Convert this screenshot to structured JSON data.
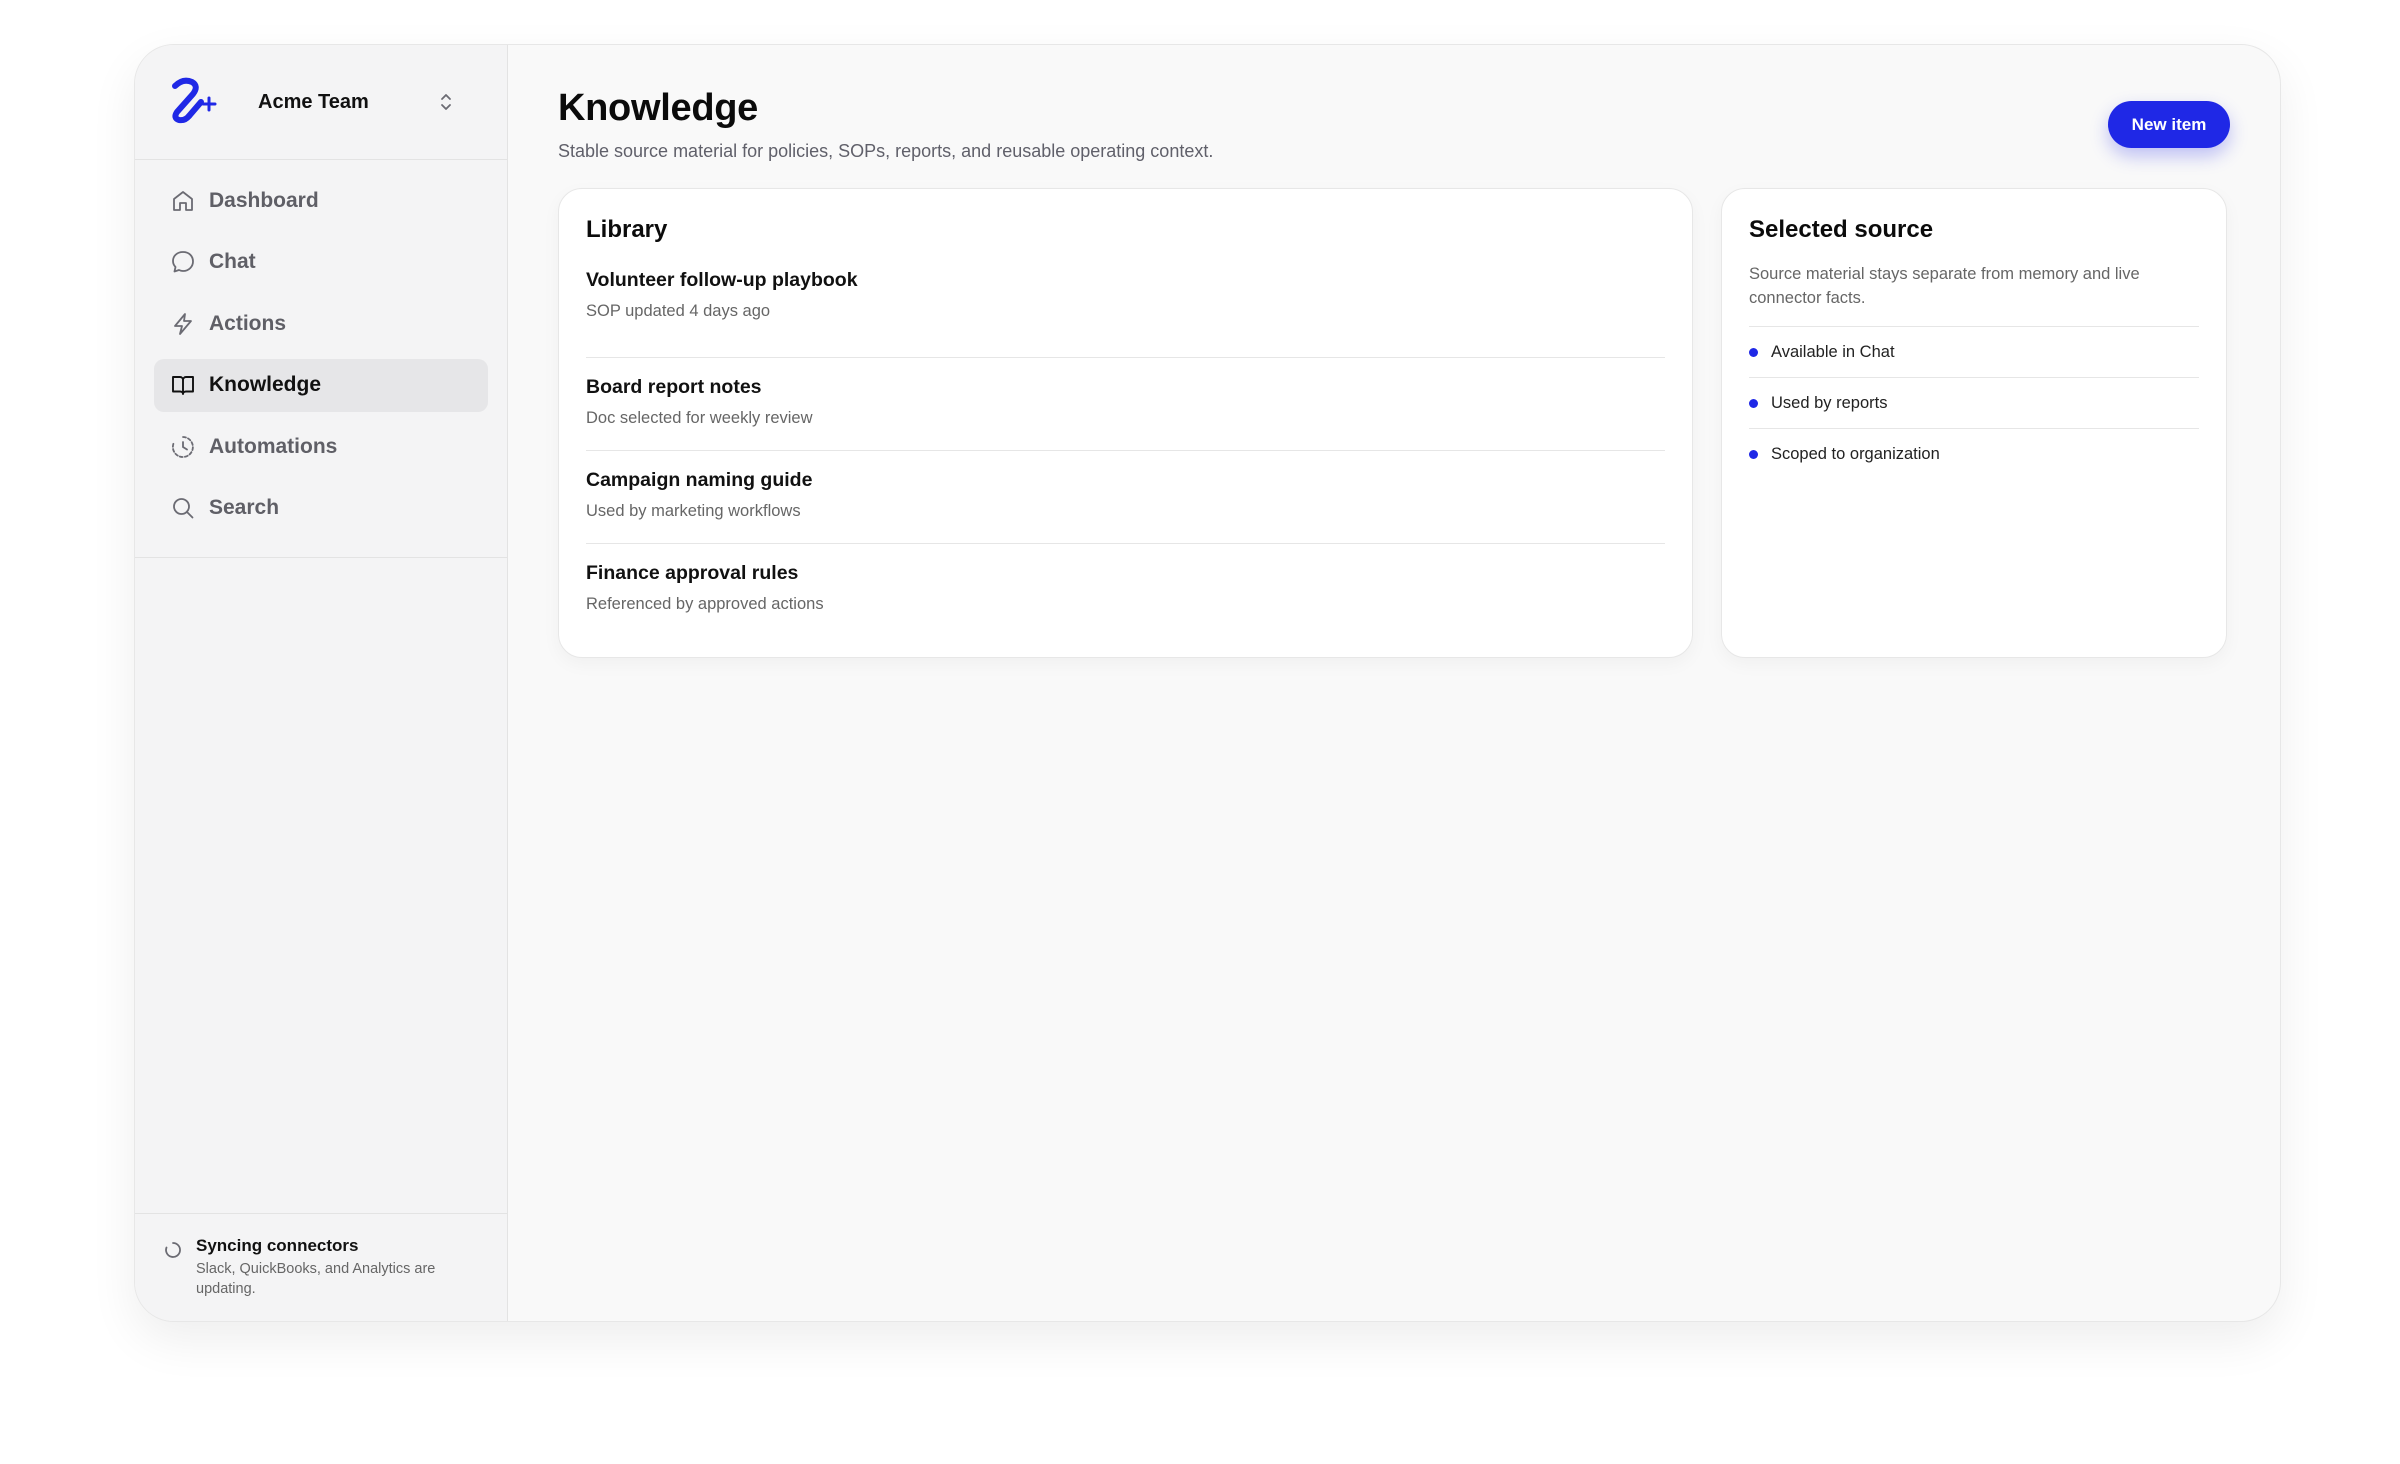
{
  "team": {
    "name": "Acme Team"
  },
  "nav": {
    "items": [
      {
        "label": "Dashboard",
        "icon": "home-icon"
      },
      {
        "label": "Chat",
        "icon": "chat-bubble-icon"
      },
      {
        "label": "Actions",
        "icon": "lightning-icon"
      },
      {
        "label": "Knowledge",
        "icon": "book-icon",
        "active": true
      },
      {
        "label": "Automations",
        "icon": "clock-cycle-icon"
      },
      {
        "label": "Search",
        "icon": "search-icon"
      }
    ]
  },
  "sync": {
    "title": "Syncing connectors",
    "description": "Slack, QuickBooks, and Analytics are updating."
  },
  "page": {
    "title": "Knowledge",
    "subtitle": "Stable source material for policies, SOPs, reports, and reusable operating context.",
    "new_button": "New item"
  },
  "library": {
    "title": "Library",
    "items": [
      {
        "name": "Volunteer follow-up playbook",
        "meta": "SOP updated 4 days ago"
      },
      {
        "name": "Board report notes",
        "meta": "Doc selected for weekly review"
      },
      {
        "name": "Campaign naming guide",
        "meta": "Used by marketing workflows"
      },
      {
        "name": "Finance approval rules",
        "meta": "Referenced by approved actions"
      }
    ]
  },
  "selected_source": {
    "title": "Selected source",
    "description": "Source material stays separate from memory and live connector facts.",
    "facts": [
      "Available in Chat",
      "Used by reports",
      "Scoped to organization"
    ]
  },
  "colors": {
    "accent": "#1f28e6",
    "active_nav_bg": "#e6e6e8"
  }
}
